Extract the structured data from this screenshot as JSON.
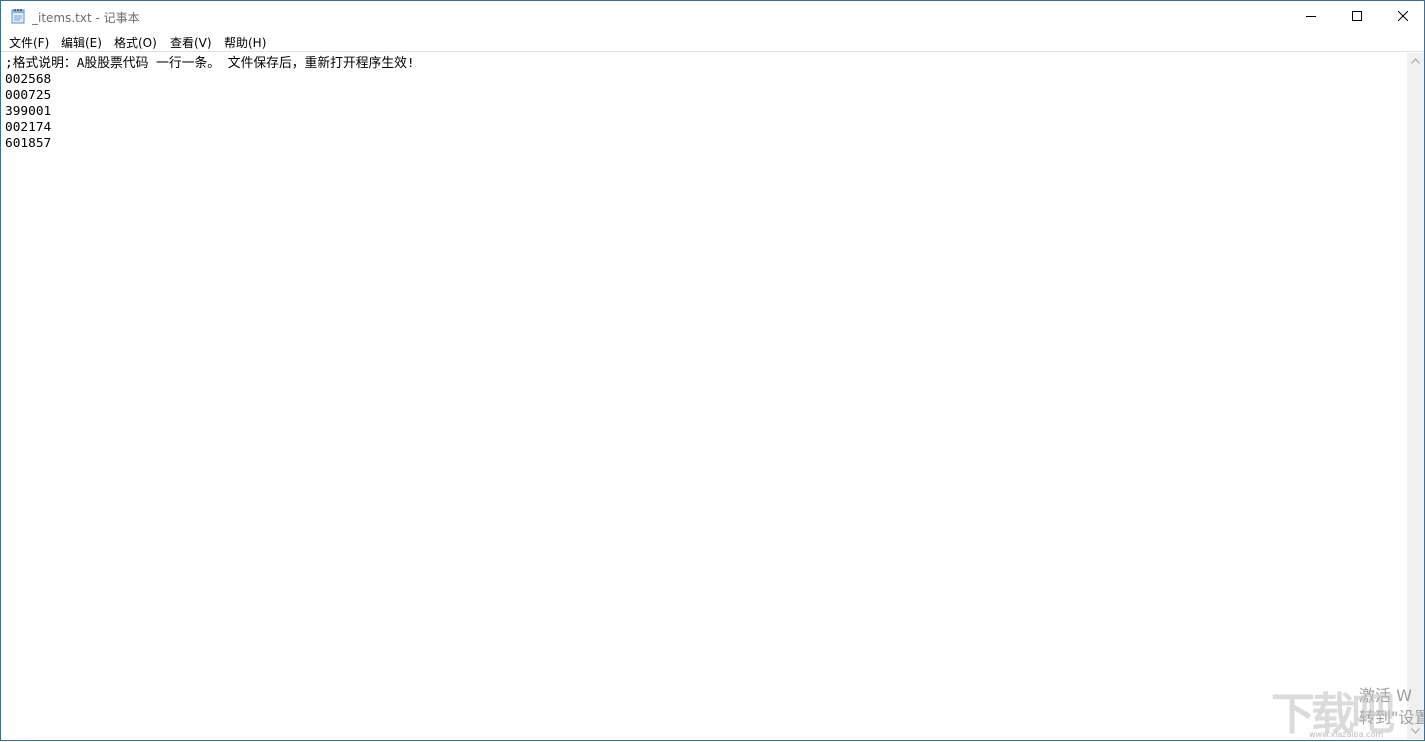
{
  "window": {
    "title": "_items.txt - 记事本",
    "app_icon": "notepad-icon",
    "controls": {
      "minimize_icon": "minimize-icon",
      "maximize_icon": "maximize-icon",
      "close_icon": "close-icon"
    }
  },
  "menubar": {
    "items": [
      {
        "label": "文件(F)"
      },
      {
        "label": "编辑(E)"
      },
      {
        "label": "格式(O)"
      },
      {
        "label": "查看(V)"
      },
      {
        "label": "帮助(H)"
      }
    ]
  },
  "editor": {
    "lines": [
      ";格式说明：A股股票代码 一行一条。 文件保存后，重新打开程序生效!",
      "002568",
      "000725",
      "399001",
      "002174",
      "601857"
    ]
  },
  "overlay": {
    "activate_line1": "激活 W",
    "activate_line2": "转到\"设置",
    "watermark_text": "下载吧",
    "watermark_url": "www.xiazaiba.com"
  },
  "colors": {
    "window_border": "#3c6e94",
    "scrollbar_bg": "#f0f0f0",
    "title_text": "#6d6d6d"
  }
}
